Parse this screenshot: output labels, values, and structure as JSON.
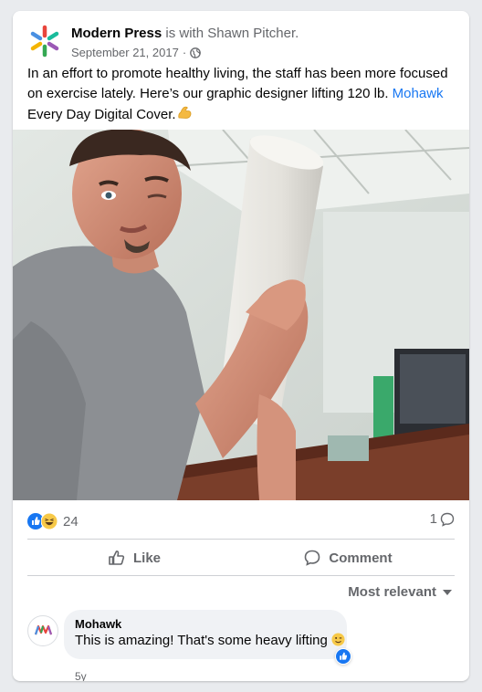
{
  "post": {
    "page_name": "Modern Press",
    "with_text": "is with",
    "tagged_name": "Shawn Pitcher.",
    "date": "September 21, 2017",
    "date_separator": "·",
    "privacy_icon": "globe-icon",
    "text_part1": "In an effort to promote healthy living, the staff has been more focused on exercise lately. Here’s our graphic designer lifting 120 lb.",
    "text_link": "Mohawk",
    "text_part2": "Every Day Digital Cover.",
    "text_emoji": "flexed-biceps-emoji",
    "photo": "man-holding-paper-roll-photo"
  },
  "reactions": {
    "icons": [
      "like-reaction-icon",
      "haha-reaction-icon"
    ],
    "count": "24",
    "comment_count": "1"
  },
  "actions": {
    "like_label": "Like",
    "comment_label": "Comment"
  },
  "comments": {
    "sort_label": "Most relevant",
    "items": [
      {
        "author": "Mohawk",
        "text": "This is amazing! That's some heavy lifting",
        "emoji": "winking-face-emoji",
        "reaction": "like-reaction-icon",
        "time": "5y"
      }
    ]
  },
  "colors": {
    "link": "#1877f2",
    "secondary_text": "#65676b",
    "background": "#e9ebee",
    "bubble": "#f0f2f5"
  }
}
